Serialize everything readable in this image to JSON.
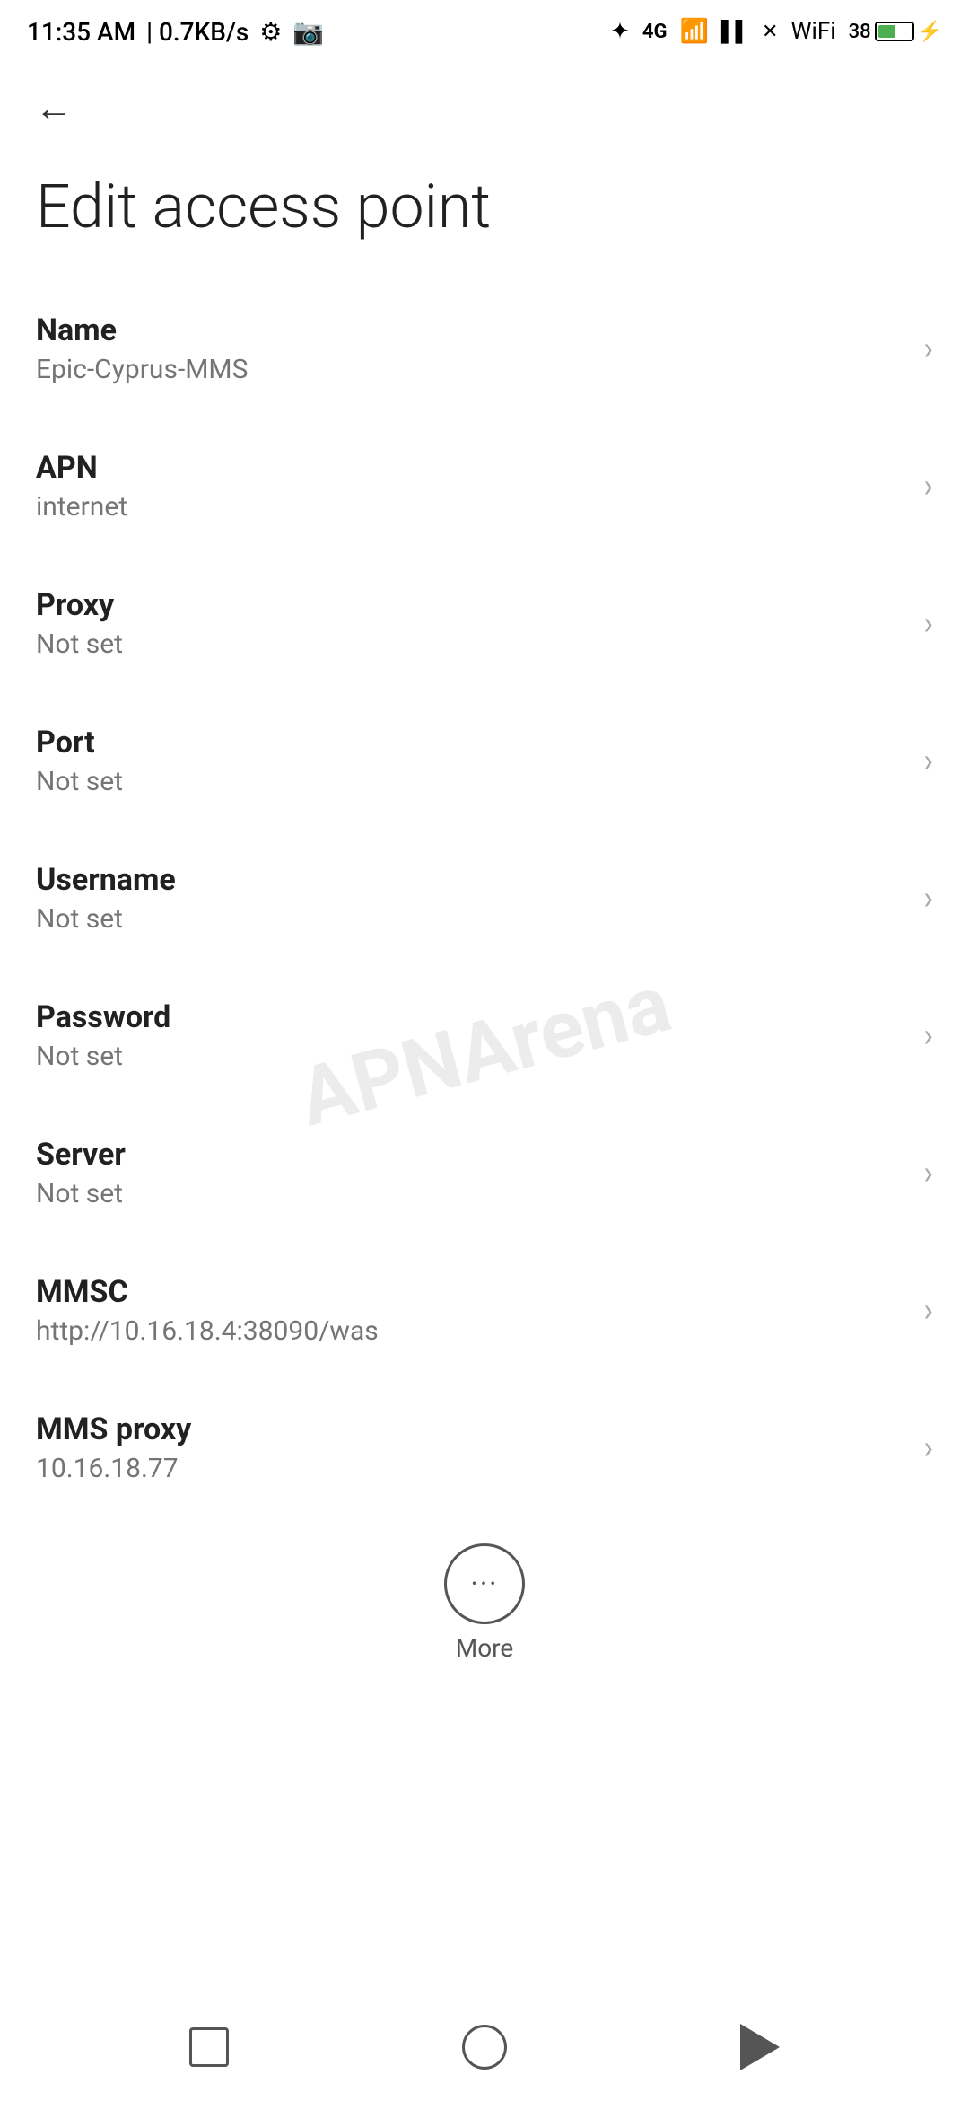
{
  "statusBar": {
    "time": "11:35 AM",
    "speed": "0.7KB/s"
  },
  "toolbar": {
    "back_label": "←"
  },
  "page": {
    "title": "Edit access point"
  },
  "settings": {
    "items": [
      {
        "label": "Name",
        "value": "Epic-Cyprus-MMS"
      },
      {
        "label": "APN",
        "value": "internet"
      },
      {
        "label": "Proxy",
        "value": "Not set"
      },
      {
        "label": "Port",
        "value": "Not set"
      },
      {
        "label": "Username",
        "value": "Not set"
      },
      {
        "label": "Password",
        "value": "Not set"
      },
      {
        "label": "Server",
        "value": "Not set"
      },
      {
        "label": "MMSC",
        "value": "http://10.16.18.4:38090/was"
      },
      {
        "label": "MMS proxy",
        "value": "10.16.18.77"
      }
    ]
  },
  "more": {
    "label": "More",
    "dots": "···"
  },
  "watermark": {
    "text": "APNArena"
  }
}
